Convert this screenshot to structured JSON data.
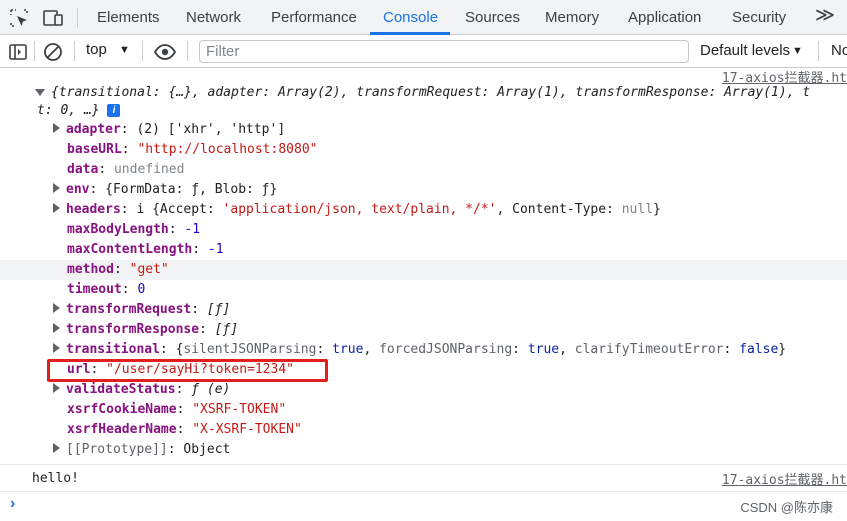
{
  "tabs": [
    "Elements",
    "Network",
    "Performance",
    "Console",
    "Sources",
    "Memory",
    "Application",
    "Security"
  ],
  "active_tab": "Console",
  "more_tabs_label": "≫",
  "toolbar": {
    "context": "top",
    "filter_placeholder": "Filter",
    "levels": "Default levels",
    "issues_partial": "No"
  },
  "console": {
    "source_link": "17-axios拦截器.ht",
    "object_summary_1": "{transitional: {…}, adapter: Array(2), transformRequest: Array(1), transformResponse: Array(1), t",
    "object_summary_2": "t: 0, …}",
    "props": {
      "adapter_key": "adapter",
      "adapter_val": "(2) ['xhr', 'http']",
      "baseURL_key": "baseURL",
      "baseURL_val": "\"http://localhost:8080\"",
      "data_key": "data",
      "data_val": "undefined",
      "env_key": "env",
      "env_val": "{FormData: ƒ, Blob: ƒ}",
      "headers_key": "headers",
      "headers_prefix": "i {Accept: ",
      "headers_accept": "'application/json, text/plain, */*'",
      "headers_mid": ", Content-Type: ",
      "headers_ct": "null",
      "headers_end": "}",
      "maxBodyLength_key": "maxBodyLength",
      "maxBodyLength_val": "-1",
      "maxContentLength_key": "maxContentLength",
      "maxContentLength_val": "-1",
      "method_key": "method",
      "method_val": "\"get\"",
      "timeout_key": "timeout",
      "timeout_val": "0",
      "transformRequest_key": "transformRequest",
      "transformRequest_val": "[ƒ]",
      "transformResponse_key": "transformResponse",
      "transformResponse_val": "[ƒ]",
      "transitional_key": "transitional",
      "transitional_open": "{",
      "t_silent_key": "silentJSONParsing",
      "t_silent_val": "true",
      "t_forced_key": "forcedJSONParsing",
      "t_forced_val": "true",
      "t_clarify_key": "clarifyTimeoutError",
      "t_clarify_val": "false",
      "transitional_close": "}",
      "url_key": "url",
      "url_val": "\"/user/sayHi?token=1234\"",
      "validateStatus_key": "validateStatus",
      "validateStatus_val": "ƒ (e)",
      "xsrfCookieName_key": "xsrfCookieName",
      "xsrfCookieName_val": "\"XSRF-TOKEN\"",
      "xsrfHeaderName_key": "xsrfHeaderName",
      "xsrfHeaderName_val": "\"X-XSRF-TOKEN\"",
      "prototype_key": "[[Prototype]]",
      "prototype_val": "Object"
    },
    "log2": "hello!",
    "log2_source": "17-axios拦截器.ht"
  },
  "watermark": "CSDN @陈亦康",
  "colors": {
    "accent": "#1a73e8",
    "highlight_box": "#e21f1f",
    "key": "#881280",
    "string": "#c41a16",
    "number": "#1c00cf"
  },
  "icons": [
    "inspect-element-icon",
    "device-toolbar-icon",
    "sidebar-toggle-icon",
    "clear-console-icon",
    "eye-icon",
    "info-icon",
    "prompt-chevron-icon"
  ]
}
